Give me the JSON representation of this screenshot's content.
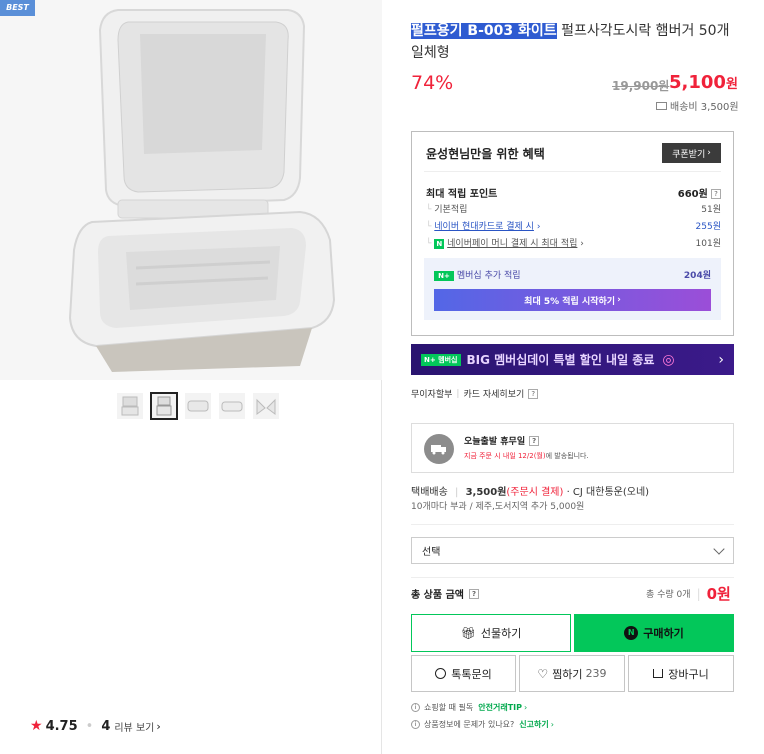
{
  "badge": "BEST",
  "rating": {
    "score": "4.75",
    "reviews": "4",
    "reviews_label": "리뷰 보기"
  },
  "product": {
    "title_highlight": "펄프용기 B-003 화이트",
    "title_rest": " 펄프사각도시락 햄버거 50개 일체형",
    "discount": "74%",
    "original_price": "19,900원",
    "price": "5,100",
    "price_unit": "원",
    "shipping_fee": "배송비 3,500원"
  },
  "benefits": {
    "heading": "윤성현님만을 위한 혜택",
    "coupon_button": "쿠폰받기",
    "max_points_label": "최대 적립 포인트",
    "max_points_value": "660원",
    "items": [
      {
        "label": "기본적립",
        "value": "51원"
      },
      {
        "label": "네이버 현대카드로 결제 시",
        "value": "255원"
      },
      {
        "label": "네이버페이 머니 결제 시 최대 적립",
        "value": "101원"
      }
    ],
    "membership_label": "멤버십 추가 적립",
    "membership_value": "204원",
    "membership_button": "최대 5% 적립 시작하기"
  },
  "banner": {
    "badge": "멤버십",
    "text": "BIG 멤버십데이 특별 할인 내일 종료"
  },
  "installment": {
    "label": "무이자할부",
    "link": "카드 자세히보기"
  },
  "delivery": {
    "title": "오늘출발 휴무일",
    "notice": "지금 주문 시 내일 12/2(월)",
    "notice_suffix": "에 발송됩니다.",
    "method": "택배배송",
    "fee": "3,500원",
    "fee_note": "(주문시 결제)",
    "carrier": "· CJ 대한통운(오네)",
    "extra": "10개마다 부과 / 제주,도서지역 추가 5,000원"
  },
  "select": {
    "placeholder": "선택"
  },
  "total": {
    "label": "총 상품 금액",
    "qty": "총 수량 0개",
    "amount": "0원"
  },
  "buttons": {
    "gift": "선물하기",
    "buy": "구매하기",
    "inquiry": "톡톡문의",
    "wish": "찜하기",
    "wish_count": "239",
    "cart": "장바구니"
  },
  "footer": {
    "line1": "쇼핑할 때 필독",
    "line1_link": "안전거래TIP",
    "line2": "상품정보에 문제가 있나요?",
    "line2_link": "신고하기"
  },
  "colors": {
    "accent": "#f0223a",
    "green": "#03c75a",
    "link": "#2a55c4"
  }
}
